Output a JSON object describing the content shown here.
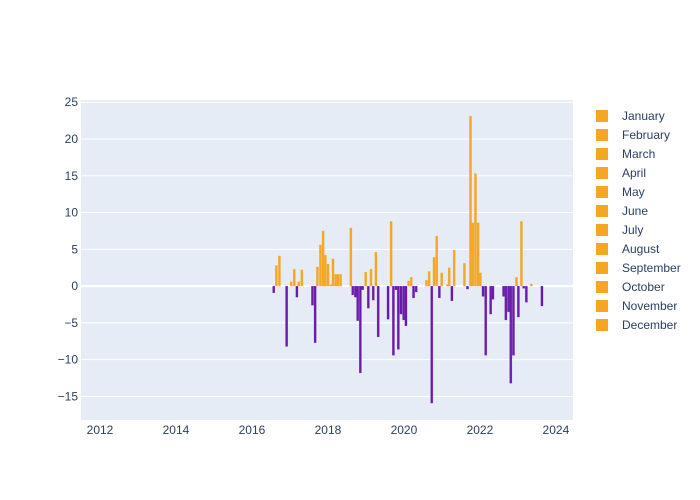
{
  "chart_data": {
    "type": "bar",
    "title": "",
    "xlabel": "",
    "ylabel": "",
    "xlim": [
      2011.5,
      2024.45
    ],
    "ylim": [
      -18.2,
      25.3
    ],
    "grid": true,
    "legend_position": "right",
    "x_ticks": [
      2012,
      2014,
      2016,
      2018,
      2020,
      2022,
      2024
    ],
    "x_tick_labels": [
      "2012",
      "2014",
      "2016",
      "2018",
      "2020",
      "2022",
      "2024"
    ],
    "y_ticks": [
      -15,
      -10,
      -5,
      0,
      5,
      10,
      15,
      20,
      25
    ],
    "y_tick_labels": [
      "−15",
      "−10",
      "−5",
      "0",
      "5",
      "10",
      "15",
      "20",
      "25"
    ],
    "colors": {
      "positive": "#F5A623",
      "negative": "#6A1BA8",
      "plot_bg": "#E5ECF6",
      "grid": "#FFFFFF"
    },
    "legend": [
      "January",
      "February",
      "March",
      "April",
      "May",
      "June",
      "July",
      "August",
      "September",
      "October",
      "November",
      "December"
    ],
    "points": [
      {
        "x": 2012.5,
        "y": 0.05
      },
      {
        "x": 2013.5,
        "y": 0.05
      },
      {
        "x": 2014.5,
        "y": 0.05
      },
      {
        "x": 2015.5,
        "y": 0.05
      },
      {
        "x": 2016.57,
        "y": -0.9
      },
      {
        "x": 2016.64,
        "y": 2.8
      },
      {
        "x": 2016.72,
        "y": 4.1
      },
      {
        "x": 2016.91,
        "y": -8.2
      },
      {
        "x": 2017.03,
        "y": 0.6
      },
      {
        "x": 2017.11,
        "y": 2.3
      },
      {
        "x": 2017.18,
        "y": -1.5
      },
      {
        "x": 2017.23,
        "y": 0.6
      },
      {
        "x": 2017.31,
        "y": 2.2
      },
      {
        "x": 2017.59,
        "y": -2.6
      },
      {
        "x": 2017.66,
        "y": -7.7
      },
      {
        "x": 2017.72,
        "y": 2.6
      },
      {
        "x": 2017.8,
        "y": 5.6
      },
      {
        "x": 2017.87,
        "y": 7.5
      },
      {
        "x": 2017.93,
        "y": 4.2
      },
      {
        "x": 2018.0,
        "y": 3.0
      },
      {
        "x": 2018.07,
        "y": 0.2
      },
      {
        "x": 2018.13,
        "y": 3.7
      },
      {
        "x": 2018.2,
        "y": 1.6
      },
      {
        "x": 2018.26,
        "y": 1.6
      },
      {
        "x": 2018.33,
        "y": 1.6
      },
      {
        "x": 2018.6,
        "y": 7.9
      },
      {
        "x": 2018.65,
        "y": -1.2
      },
      {
        "x": 2018.72,
        "y": -1.5
      },
      {
        "x": 2018.78,
        "y": -4.7
      },
      {
        "x": 2018.85,
        "y": -11.8
      },
      {
        "x": 2018.91,
        "y": -0.5
      },
      {
        "x": 2018.99,
        "y": 1.9
      },
      {
        "x": 2019.06,
        "y": -3.0
      },
      {
        "x": 2019.13,
        "y": 2.3
      },
      {
        "x": 2019.19,
        "y": -1.9
      },
      {
        "x": 2019.26,
        "y": 4.6
      },
      {
        "x": 2019.32,
        "y": -6.9
      },
      {
        "x": 2019.58,
        "y": -4.5
      },
      {
        "x": 2019.66,
        "y": 8.8
      },
      {
        "x": 2019.72,
        "y": -9.4
      },
      {
        "x": 2019.79,
        "y": -0.5
      },
      {
        "x": 2019.85,
        "y": -8.6
      },
      {
        "x": 2019.92,
        "y": -3.8
      },
      {
        "x": 2019.99,
        "y": -4.6
      },
      {
        "x": 2020.05,
        "y": -5.4
      },
      {
        "x": 2020.12,
        "y": 0.7
      },
      {
        "x": 2020.19,
        "y": 1.2
      },
      {
        "x": 2020.25,
        "y": -1.6
      },
      {
        "x": 2020.32,
        "y": -0.8
      },
      {
        "x": 2020.59,
        "y": 0.8
      },
      {
        "x": 2020.66,
        "y": 2.0
      },
      {
        "x": 2020.73,
        "y": -15.9
      },
      {
        "x": 2020.79,
        "y": 3.9
      },
      {
        "x": 2020.86,
        "y": 6.8
      },
      {
        "x": 2020.93,
        "y": -1.6
      },
      {
        "x": 2020.99,
        "y": 1.8
      },
      {
        "x": 2021.14,
        "y": 0.2
      },
      {
        "x": 2021.19,
        "y": 2.5
      },
      {
        "x": 2021.26,
        "y": -2.0
      },
      {
        "x": 2021.32,
        "y": 4.9
      },
      {
        "x": 2021.59,
        "y": 3.1
      },
      {
        "x": 2021.67,
        "y": -0.4
      },
      {
        "x": 2021.75,
        "y": 23.1
      },
      {
        "x": 2021.81,
        "y": 8.6
      },
      {
        "x": 2021.88,
        "y": 15.3
      },
      {
        "x": 2021.95,
        "y": 8.6
      },
      {
        "x": 2022.01,
        "y": 1.8
      },
      {
        "x": 2022.08,
        "y": -1.4
      },
      {
        "x": 2022.15,
        "y": -9.4
      },
      {
        "x": 2022.28,
        "y": -3.8
      },
      {
        "x": 2022.34,
        "y": -1.8
      },
      {
        "x": 2022.62,
        "y": -1.4
      },
      {
        "x": 2022.68,
        "y": -4.6
      },
      {
        "x": 2022.75,
        "y": -3.5
      },
      {
        "x": 2022.81,
        "y": -13.2
      },
      {
        "x": 2022.88,
        "y": -9.4
      },
      {
        "x": 2022.96,
        "y": 1.2
      },
      {
        "x": 2023.01,
        "y": -4.2
      },
      {
        "x": 2023.09,
        "y": 8.8
      },
      {
        "x": 2023.15,
        "y": -0.3
      },
      {
        "x": 2023.22,
        "y": -2.2
      },
      {
        "x": 2023.35,
        "y": 0.3
      },
      {
        "x": 2023.63,
        "y": -2.7
      }
    ]
  }
}
